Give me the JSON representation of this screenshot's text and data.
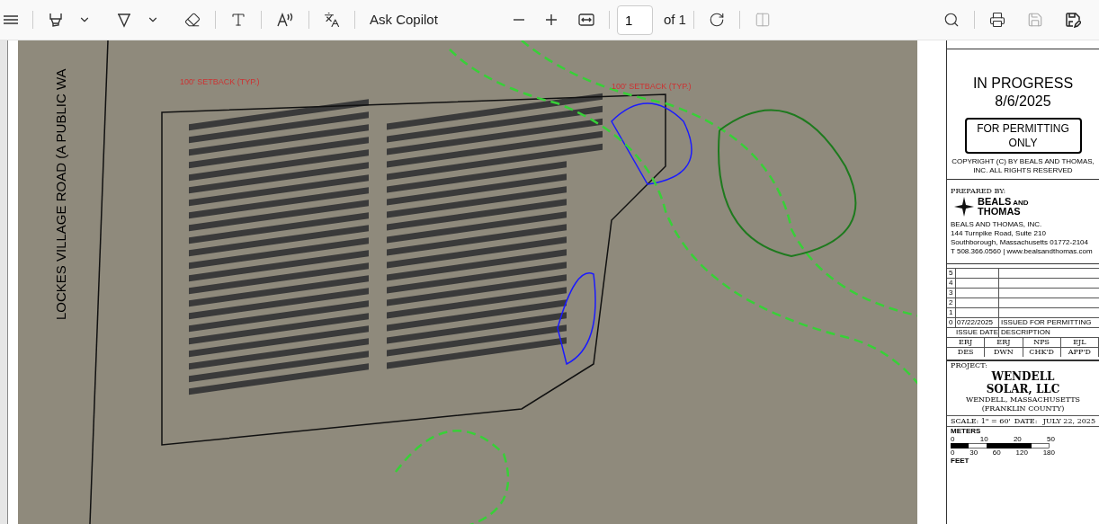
{
  "toolbar": {
    "ask_label": "Ask Copilot",
    "page_number": "1",
    "page_total": "of 1"
  },
  "map": {
    "road_label": "LOCKES VILLAGE ROAD (A PUBLIC WA",
    "setback_labels": [
      "100' SETBACK (TYP.)",
      "100' SETBACK (TYP.)"
    ]
  },
  "title_block": {
    "status": "IN PROGRESS",
    "status_date": "8/6/2025",
    "permit_note": "FOR PERMITTING ONLY",
    "copyright": "COPYRIGHT (C) BY BEALS AND THOMAS, INC. ALL RIGHTS RESERVED",
    "prepared_by": "PREPARED BY:",
    "logo_lines": [
      "BEALS",
      "AND",
      "THOMAS"
    ],
    "firm_lines": [
      "BEALS AND THOMAS, INC.",
      "144 Turnpike Road, Suite 210",
      "Southborough, Massachusetts 01772-2104",
      "T 508.366.0560 | www.bealsandthomas.com"
    ],
    "revisions": [
      {
        "no": "5"
      },
      {
        "no": "4"
      },
      {
        "no": "3"
      },
      {
        "no": "2"
      },
      {
        "no": "1"
      },
      {
        "no": "0",
        "date": "07/22/2025",
        "desc": "ISSUED FOR PERMITTING"
      }
    ],
    "revision_header": [
      "ISSUE DATE",
      "DESCRIPTION"
    ],
    "initials": [
      "ERJ",
      "ERJ",
      "NPS",
      "EJL"
    ],
    "roles": [
      "DES",
      "DWN",
      "CHK'D",
      "APP'D"
    ],
    "project_label": "PROJECT:",
    "project_name": "WENDELL SOLAR, LLC",
    "project_location": "WENDELL, MASSACHUSETTS",
    "project_county": "(FRANKLIN COUNTY)",
    "scale": "SCALE: 1\" = 60'",
    "date_label": "DATE:",
    "date": "JULY 22, 2025",
    "scale_bar": {
      "meters_label": "METERS",
      "meters": [
        "0",
        "10",
        "20",
        "50"
      ],
      "feet_label": "FEET",
      "feet": [
        "0",
        "30",
        "60",
        "120",
        "180"
      ]
    }
  }
}
